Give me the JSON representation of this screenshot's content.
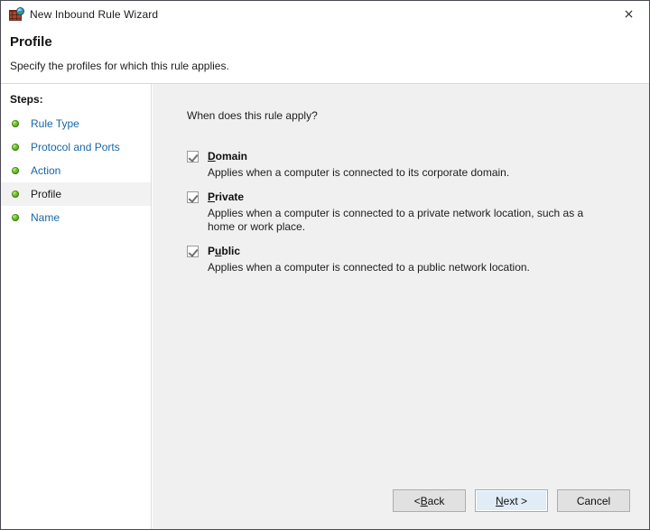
{
  "window": {
    "title": "New Inbound Rule Wizard",
    "icon": "firewall-brick-globe-icon",
    "close_label": "×"
  },
  "header": {
    "title": "Profile",
    "subtitle": "Specify the profiles for which this rule applies."
  },
  "sidebar": {
    "label": "Steps:",
    "items": [
      {
        "label": "Rule Type",
        "current": false
      },
      {
        "label": "Protocol and Ports",
        "current": false
      },
      {
        "label": "Action",
        "current": false
      },
      {
        "label": "Profile",
        "current": true
      },
      {
        "label": "Name",
        "current": false
      }
    ]
  },
  "main": {
    "question": "When does this rule apply?",
    "options": [
      {
        "name": "domain",
        "label_pre": "",
        "label_acc": "D",
        "label_post": "omain",
        "checked": true,
        "description": "Applies when a computer is connected to its corporate domain."
      },
      {
        "name": "private",
        "label_pre": "",
        "label_acc": "P",
        "label_post": "rivate",
        "checked": true,
        "description": "Applies when a computer is connected to a private network location, such as a home or work place."
      },
      {
        "name": "public",
        "label_pre": "P",
        "label_acc": "u",
        "label_post": "blic",
        "checked": true,
        "description": "Applies when a computer is connected to a public network location."
      }
    ]
  },
  "footer": {
    "buttons": [
      {
        "name": "back",
        "pre": "< ",
        "acc": "B",
        "post": "ack",
        "default": false
      },
      {
        "name": "next",
        "pre": "",
        "acc": "N",
        "post": "ext >",
        "default": true
      },
      {
        "name": "cancel",
        "pre": "Cancel",
        "acc": "",
        "post": "",
        "default": false
      }
    ]
  },
  "colors": {
    "link": "#1767a8",
    "panel": "#f0f0f0",
    "default_button_border": "#7eb4ea"
  }
}
